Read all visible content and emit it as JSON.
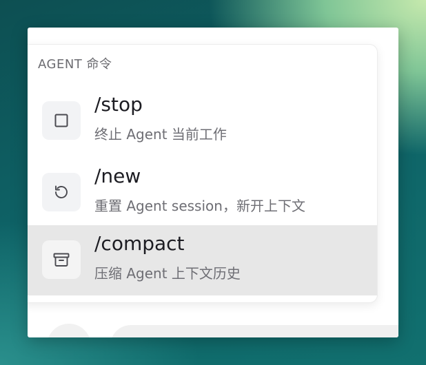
{
  "menu": {
    "header": "AGENT 命令",
    "items": [
      {
        "command": "/stop",
        "description": "终止 Agent 当前工作",
        "icon": "square-stop-icon",
        "selected": false
      },
      {
        "command": "/new",
        "description": "重置 Agent session，新开上下文",
        "icon": "rotate-ccw-icon",
        "selected": false
      },
      {
        "command": "/compact",
        "description": "压缩 Agent 上下文历史",
        "icon": "archive-icon",
        "selected": true
      }
    ]
  },
  "colors": {
    "selected_background": "#e7e7e7",
    "icon_box_background": "#f2f3f5",
    "command_text": "#1c1c22",
    "description_text": "#6e6e74"
  }
}
